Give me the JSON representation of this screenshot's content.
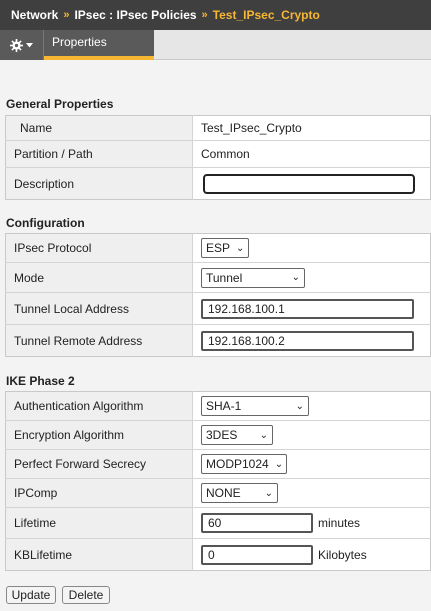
{
  "breadcrumb": {
    "items": [
      "Network",
      "IPsec : IPsec Policies",
      "Test_IPsec_Crypto"
    ],
    "separator": "»"
  },
  "tabs": {
    "settings_icon": "gear-icon",
    "active": "Properties"
  },
  "general": {
    "title": "General Properties",
    "name_label": "Name",
    "name_value": "Test_IPsec_Crypto",
    "partition_label": "Partition / Path",
    "partition_value": "Common",
    "description_label": "Description",
    "description_value": ""
  },
  "configuration": {
    "title": "Configuration",
    "protocol_label": "IPsec Protocol",
    "protocol_value": "ESP",
    "mode_label": "Mode",
    "mode_value": "Tunnel",
    "local_label": "Tunnel Local Address",
    "local_value": "192.168.100.1",
    "remote_label": "Tunnel Remote Address",
    "remote_value": "192.168.100.2"
  },
  "ike": {
    "title": "IKE Phase 2",
    "auth_label": "Authentication Algorithm",
    "auth_value": "SHA-1",
    "enc_label": "Encryption Algorithm",
    "enc_value": "3DES",
    "pfs_label": "Perfect Forward Secrecy",
    "pfs_value": "MODP1024",
    "ipcomp_label": "IPComp",
    "ipcomp_value": "NONE",
    "lifetime_label": "Lifetime",
    "lifetime_value": "60",
    "lifetime_unit": "minutes",
    "kblifetime_label": "KBLifetime",
    "kblifetime_value": "0",
    "kblifetime_unit": "Kilobytes"
  },
  "buttons": {
    "update": "Update",
    "delete": "Delete"
  },
  "colors": {
    "accent": "#f7b733",
    "header_bg": "#3f3f3f",
    "marker": "#2f6db3"
  }
}
